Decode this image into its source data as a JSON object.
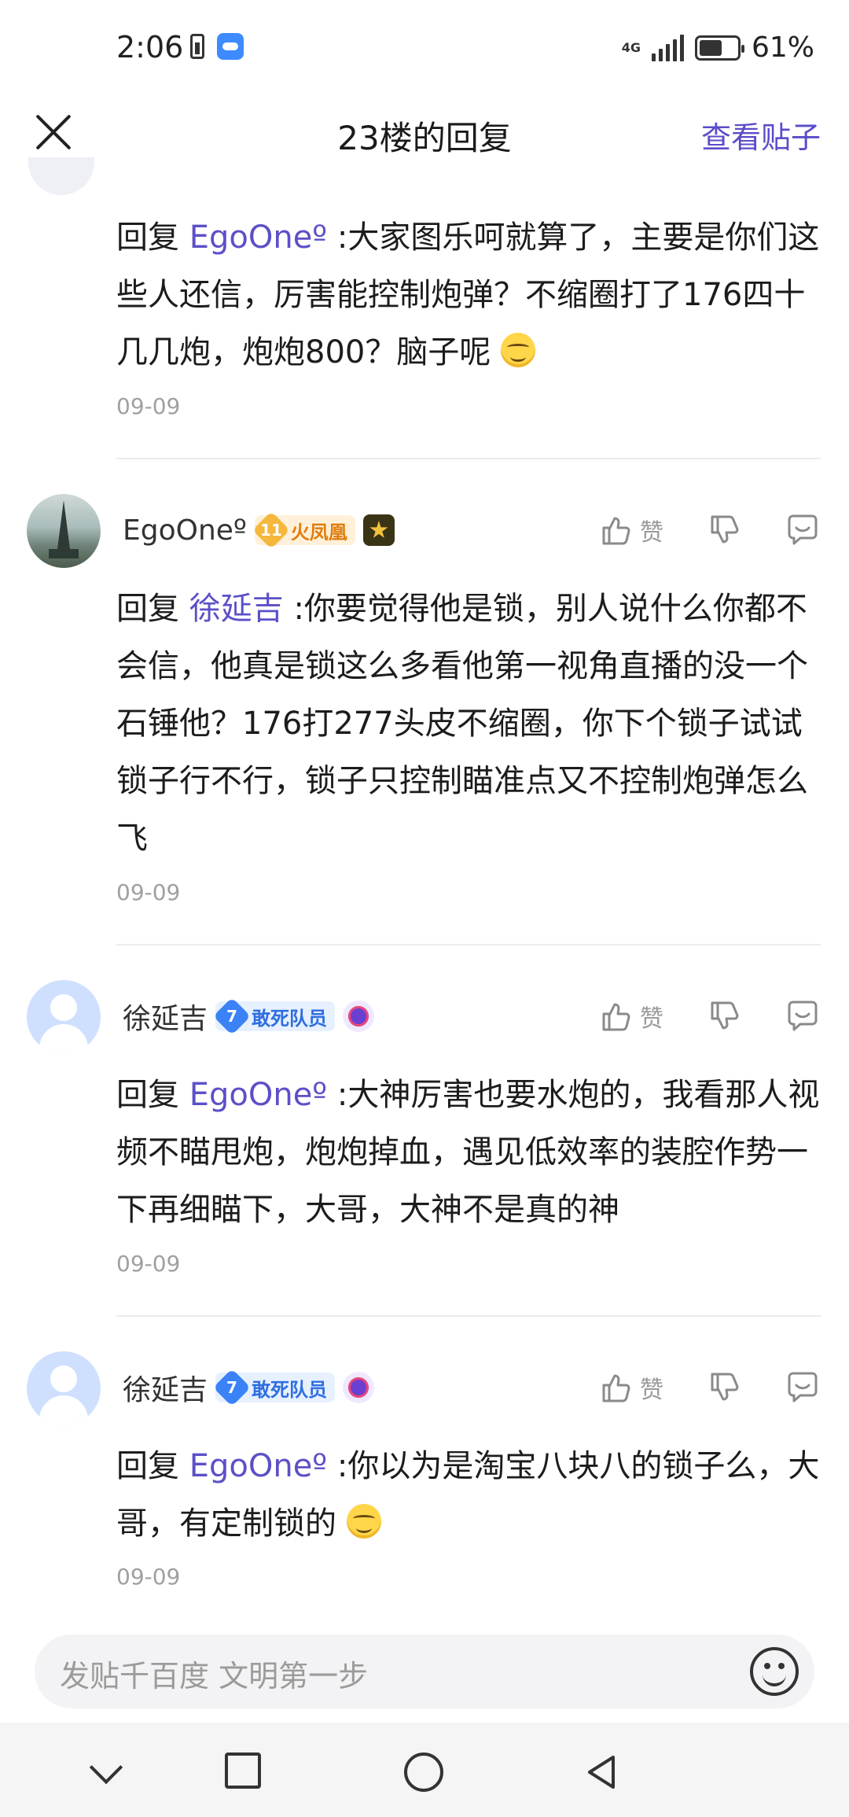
{
  "status_bar": {
    "time": "2:06",
    "network": "4G",
    "battery_percent": "61%",
    "battery_level": 0.61
  },
  "header": {
    "title": "23楼的回复",
    "view_post": "查看贴子"
  },
  "like_label": "赞",
  "replies": [
    {
      "prefix": "回复",
      "mention": "EgoOneº",
      "text": ":大家图乐呵就算了，主要是你们这些人还信，厉害能控制炮弹？不缩圈打了176四十几几炮，炮炮800？脑子呢",
      "emoji": "grin-emoji",
      "date": "09-09"
    },
    {
      "username": "EgoOneº",
      "level": "11",
      "level_title": "火凤凰",
      "prefix": "回复",
      "mention": "徐延吉",
      "text": ":你要觉得他是锁，别人说什么你都不会信，他真是锁这么多看他第一视角直播的没一个石锤他？176打277头皮不缩圈，你下个锁子试试锁子行不行，锁子只控制瞄准点又不控制炮弹怎么飞",
      "date": "09-09"
    },
    {
      "username": "徐延吉",
      "level": "7",
      "level_title": "敢死队员",
      "prefix": "回复",
      "mention": "EgoOneº",
      "text": ":大神厉害也要水炮的，我看那人视频不瞄甩炮，炮炮掉血，遇见低效率的装腔作势一下再细瞄下，大哥，大神不是真的神",
      "date": "09-09"
    },
    {
      "username": "徐延吉",
      "level": "7",
      "level_title": "敢死队员",
      "prefix": "回复",
      "mention": "EgoOneº",
      "text": ":你以为是淘宝八块八的锁子么，大哥，有定制锁的",
      "emoji": "grin-emoji",
      "date": "09-09"
    }
  ],
  "input": {
    "placeholder": "发贴千百度 文明第一步"
  },
  "colors": {
    "accent": "#5a4cc9",
    "badge_gold": "#f5b83d",
    "badge_blue": "#3b82f6"
  }
}
